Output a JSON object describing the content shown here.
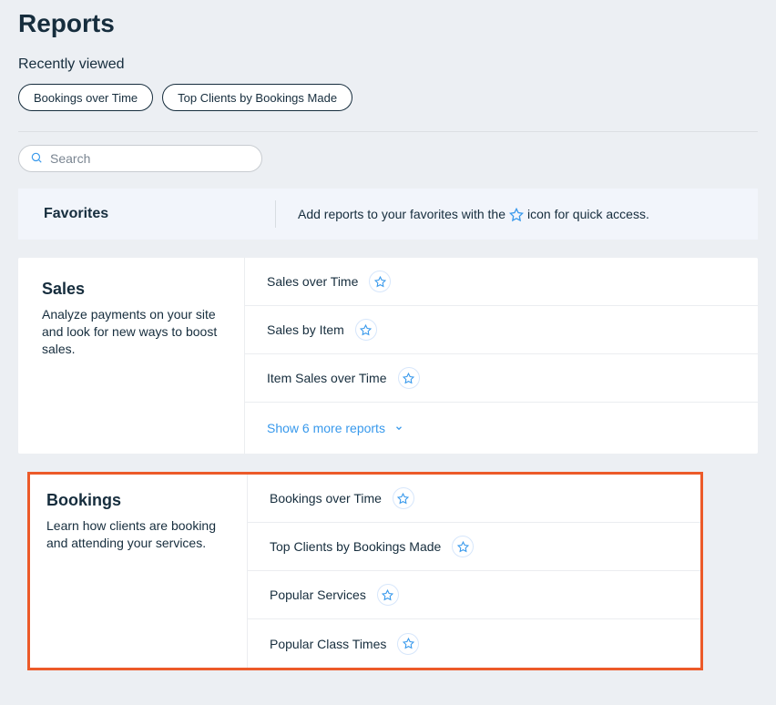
{
  "page": {
    "title": "Reports"
  },
  "recently": {
    "label": "Recently viewed",
    "items": [
      "Bookings over Time",
      "Top Clients by Bookings Made"
    ]
  },
  "search": {
    "placeholder": "Search"
  },
  "favorites": {
    "title": "Favorites",
    "help_before": "Add reports to your favorites with the",
    "help_after": "icon for quick access."
  },
  "sections": [
    {
      "title": "Sales",
      "description": "Analyze payments on your site and look for new ways to boost sales.",
      "reports": [
        "Sales over Time",
        "Sales by Item",
        "Item Sales over Time"
      ],
      "more_label": "Show 6 more reports"
    },
    {
      "title": "Bookings",
      "description": "Learn how clients are booking and attending your services.",
      "reports": [
        "Bookings over Time",
        "Top Clients by Bookings Made",
        "Popular Services",
        "Popular Class Times"
      ]
    }
  ]
}
